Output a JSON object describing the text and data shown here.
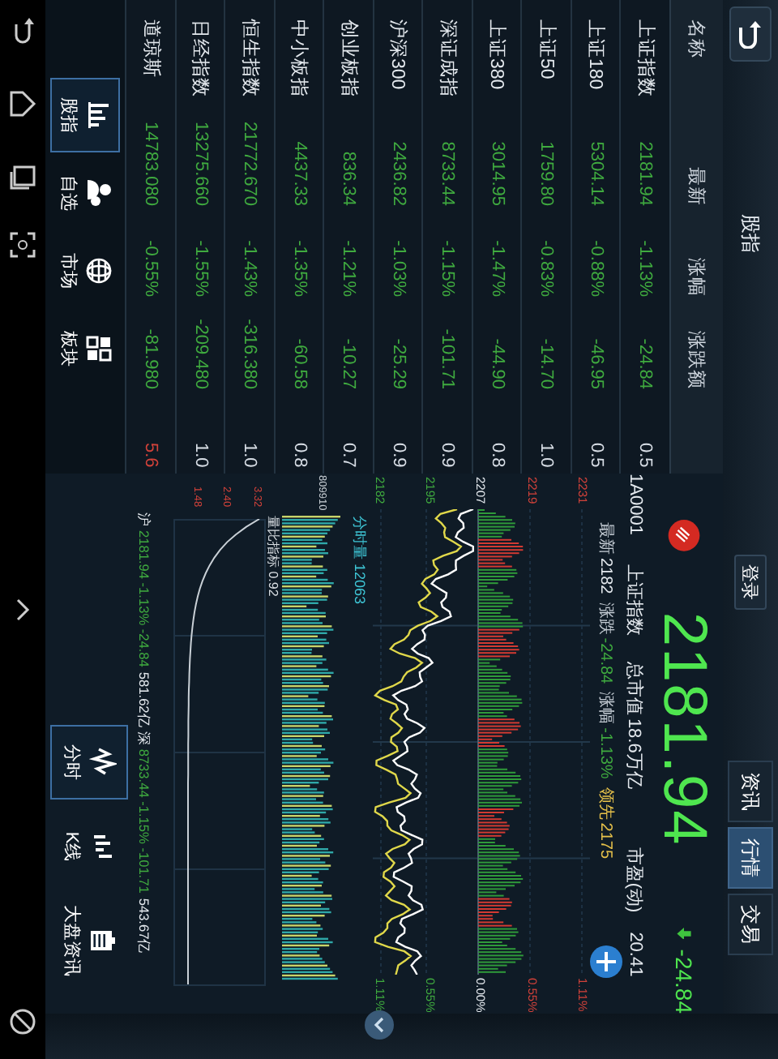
{
  "top_bar": {
    "title": "股指",
    "login": "登录",
    "tabs": [
      {
        "label": "资讯",
        "selected": false
      },
      {
        "label": "行情",
        "selected": true
      },
      {
        "label": "交易",
        "selected": false
      }
    ]
  },
  "table": {
    "columns": [
      "名称",
      "最新",
      "涨幅",
      "涨跌额"
    ],
    "rows": [
      {
        "name": "上证指数",
        "latest": "2181.94",
        "change_pct": "-1.13%",
        "change": "-24.84",
        "column_5": "0.5",
        "color": "#d8dee6"
      },
      {
        "name": "上证180",
        "latest": "5304.14",
        "change_pct": "-0.88%",
        "change": "-46.95",
        "column_5": "0.5",
        "color": "#d8dee6"
      },
      {
        "name": "上证50",
        "latest": "1759.80",
        "change_pct": "-0.83%",
        "change": "-14.70",
        "column_5": "1.0",
        "color": "#d8dee6"
      },
      {
        "name": "上证380",
        "latest": "3014.95",
        "change_pct": "-1.47%",
        "change": "-44.90",
        "column_5": "0.8",
        "color": "#d8dee6"
      },
      {
        "name": "深证成指",
        "latest": "8733.44",
        "change_pct": "-1.15%",
        "change": "-101.71",
        "column_5": "0.9",
        "color": "#d8dee6"
      },
      {
        "name": "沪深300",
        "latest": "2436.82",
        "change_pct": "-1.03%",
        "change": "-25.29",
        "column_5": "0.9",
        "color": "#d8dee6"
      },
      {
        "name": "创业板指",
        "latest": "836.34",
        "change_pct": "-1.21%",
        "change": "-10.27",
        "column_5": "0.7",
        "color": "#d8dee6"
      },
      {
        "name": "中小板指",
        "latest": "4437.33",
        "change_pct": "-1.35%",
        "change": "-60.58",
        "column_5": "0.8",
        "color": "#d8dee6"
      },
      {
        "name": "恒生指数",
        "latest": "21772.670",
        "change_pct": "-1.43%",
        "change": "-316.380",
        "column_5": "1.0",
        "color": "#d8dee6"
      },
      {
        "name": "日经指数",
        "latest": "13275.660",
        "change_pct": "-1.55%",
        "change": "-209.480",
        "column_5": "1.0",
        "color": "#d8dee6"
      },
      {
        "name": "道琼斯",
        "latest": "14783.080",
        "change_pct": "-0.55%",
        "change": "-81.980",
        "column_5": "5.6",
        "color": "#d2423a"
      }
    ]
  },
  "sections": [
    {
      "label": "股指",
      "selected": true
    },
    {
      "label": "自选",
      "selected": false
    },
    {
      "label": "市场",
      "selected": false
    },
    {
      "label": "板块",
      "selected": false
    }
  ],
  "quote": {
    "price": "2181.94",
    "change": "-24.84",
    "code": "1A0001",
    "name": "上证指数",
    "stats": [
      {
        "label": "总市值",
        "value": "18.6万亿"
      },
      {
        "label": "市盈(动)",
        "value": "20.41"
      }
    ],
    "ticker": [
      {
        "label": "最新",
        "value": "2182",
        "kind": "plain"
      },
      {
        "label": "涨跌",
        "value": "-24.84",
        "kind": "down"
      },
      {
        "label": "涨幅",
        "value": "-1.13%",
        "kind": "down"
      },
      {
        "label": "领先",
        "value": "2175",
        "kind": "lead"
      }
    ]
  },
  "chart": {
    "left_ticks": [
      "2231",
      "2219",
      "2207",
      "2195",
      "2182"
    ],
    "right_ticks": [
      "1.11%",
      "0.55%",
      "0.00%",
      "0.55%",
      "1.11%"
    ],
    "volume_label": "分时量 12063",
    "volume_max": "809910",
    "ratio_label": "量比指标 0.92",
    "ratio_ticks": [
      "3.32",
      "2.40",
      "1.48"
    ]
  },
  "summary": [
    {
      "text": "沪",
      "kind": "label"
    },
    {
      "text": "2181.94 -1.13% -24.84",
      "kind": "down"
    },
    {
      "text": "581.62亿",
      "kind": "label"
    },
    {
      "text": "深",
      "kind": "label"
    },
    {
      "text": "8733.44 -1.15% -101.71",
      "kind": "down"
    },
    {
      "text": "543.67亿",
      "kind": "label"
    }
  ],
  "chart_tabs": [
    {
      "label": "分时",
      "selected": true
    },
    {
      "label": "K线",
      "selected": false
    },
    {
      "label": "大盘资讯",
      "selected": false
    }
  ]
}
